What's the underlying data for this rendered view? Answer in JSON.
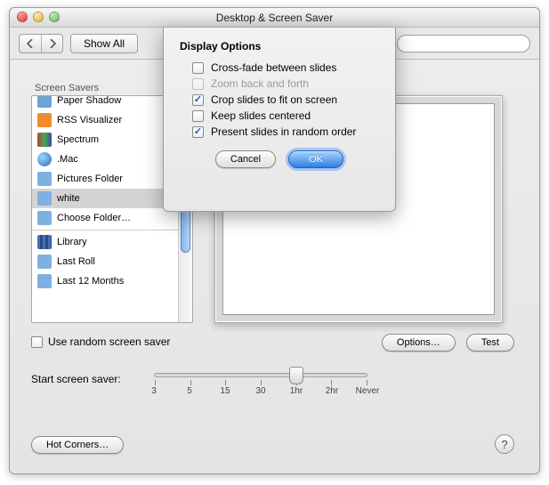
{
  "window": {
    "title": "Desktop & Screen Saver",
    "show_all": "Show All"
  },
  "sidebar": {
    "label": "Screen Savers",
    "items": [
      {
        "label": "Paper Shadow"
      },
      {
        "label": "RSS Visualizer"
      },
      {
        "label": "Spectrum"
      },
      {
        "label": ".Mac"
      },
      {
        "label": "Pictures Folder"
      },
      {
        "label": "white",
        "selected": true
      },
      {
        "label": "Choose Folder…"
      },
      {
        "label": "Library"
      },
      {
        "label": "Last Roll"
      },
      {
        "label": "Last 12 Months"
      }
    ]
  },
  "random_checkbox": "Use random screen saver",
  "options_btn": "Options…",
  "test_btn": "Test",
  "slider": {
    "label": "Start screen saver:",
    "ticks": [
      "3",
      "5",
      "15",
      "30",
      "1hr",
      "2hr",
      "Never"
    ],
    "value_index": 4
  },
  "hot_corners": "Hot Corners…",
  "help": "?",
  "sheet": {
    "title": "Display Options",
    "opts": [
      {
        "label": "Cross-fade between slides",
        "checked": false,
        "enabled": true
      },
      {
        "label": "Zoom back and forth",
        "checked": false,
        "enabled": false
      },
      {
        "label": "Crop slides to fit on screen",
        "checked": true,
        "enabled": true
      },
      {
        "label": "Keep slides centered",
        "checked": false,
        "enabled": true
      },
      {
        "label": "Present slides in random order",
        "checked": true,
        "enabled": true
      }
    ],
    "cancel": "Cancel",
    "ok": "OK"
  }
}
